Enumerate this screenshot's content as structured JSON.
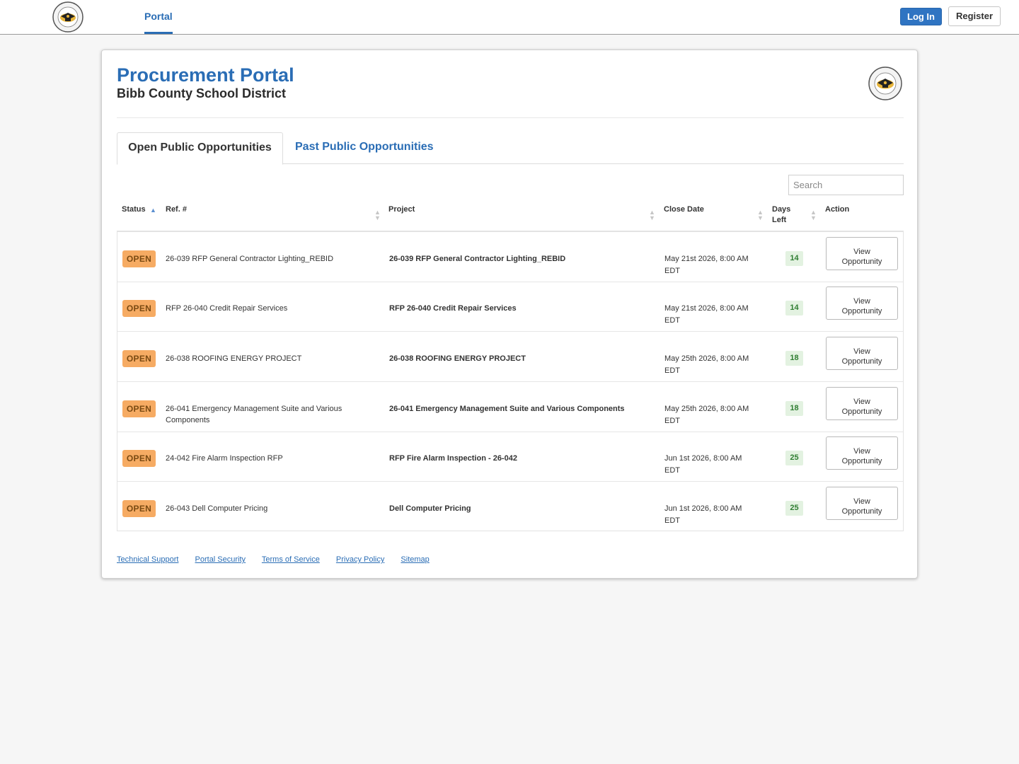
{
  "nav": {
    "logo_icon": "bibb-county-school-district-seal",
    "portal_tab": "Portal",
    "login_label": "Log In",
    "register_label": "Register"
  },
  "header": {
    "title": "Procurement Portal",
    "subtitle": "Bibb County School District",
    "logo_icon": "bibb-county-school-district-seal"
  },
  "tabs": [
    {
      "label": "Open Public Opportunities",
      "active": true
    },
    {
      "label": "Past Public Opportunities",
      "active": false
    }
  ],
  "search": {
    "placeholder": "Search",
    "value": ""
  },
  "table": {
    "columns": {
      "status": "Status",
      "ref": "Ref. #",
      "project": "Project",
      "close_date": "Close Date",
      "days_left_1": "Days",
      "days_left_2": "Left",
      "action": "Action"
    },
    "action_label_1": "View",
    "action_label_2": "Opportunity",
    "rows": [
      {
        "status": "OPEN",
        "ref": "26-039 RFP General Contractor Lighting_REBID",
        "project": "26-039 RFP General Contractor Lighting_REBID",
        "close_1": "May 21st 2026, 8:00 AM",
        "close_2": "EDT",
        "days": "14"
      },
      {
        "status": "OPEN",
        "ref": "RFP 26-040 Credit Repair Services",
        "project": "RFP 26-040 Credit Repair Services",
        "close_1": "May 21st 2026, 8:00 AM",
        "close_2": "EDT",
        "days": "14"
      },
      {
        "status": "OPEN",
        "ref": "26-038 ROOFING ENERGY PROJECT",
        "project": "26-038 ROOFING ENERGY PROJECT",
        "close_1": "May 25th 2026, 8:00 AM",
        "close_2": "EDT",
        "days": "18"
      },
      {
        "status": "OPEN",
        "ref": "26-041 Emergency Management Suite and Various Components",
        "project": "26-041 Emergency Management Suite and Various Components",
        "close_1": "May 25th 2026, 8:00 AM",
        "close_2": "EDT",
        "days": "18"
      },
      {
        "status": "OPEN",
        "ref": "24-042 Fire Alarm Inspection RFP",
        "project": "RFP Fire Alarm Inspection - 26-042",
        "close_1": "Jun 1st 2026, 8:00 AM",
        "close_2": "EDT",
        "days": "25"
      },
      {
        "status": "OPEN",
        "ref": "26-043 Dell Computer Pricing",
        "project": "Dell Computer Pricing",
        "close_1": "Jun 1st 2026, 8:00 AM",
        "close_2": "EDT",
        "days": "25"
      }
    ]
  },
  "footer": {
    "links": [
      "Technical Support",
      "Portal Security",
      "Terms of Service",
      "Privacy Policy",
      "Sitemap"
    ]
  },
  "colors": {
    "brand_blue": "#2a6db5",
    "open_badge": "#f6ab63",
    "days_badge_bg": "#e3f2e1",
    "days_badge_text": "#2f7d32"
  }
}
